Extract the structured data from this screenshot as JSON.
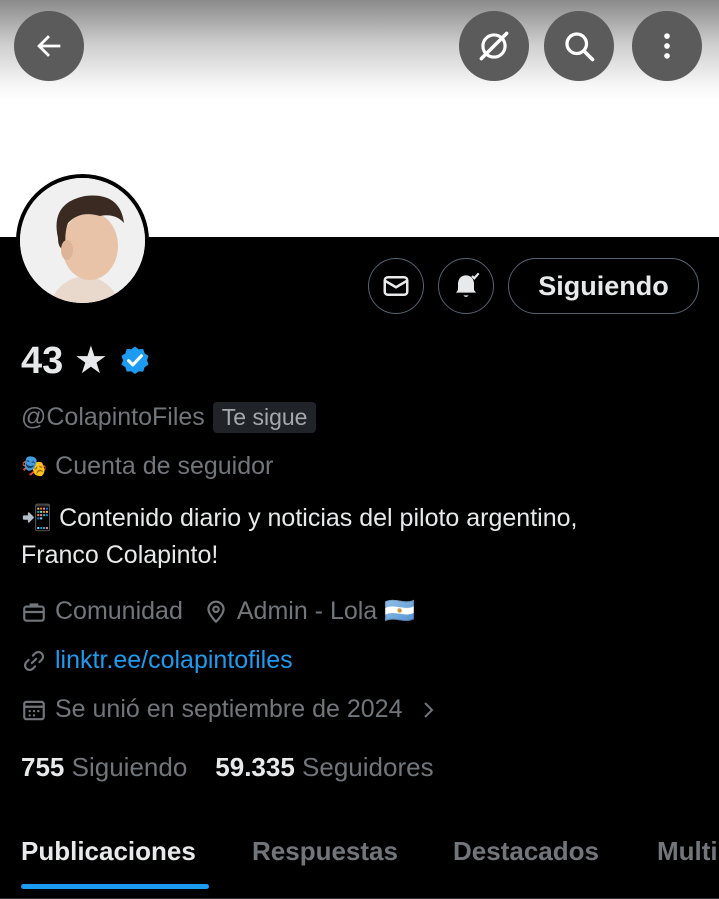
{
  "header": {
    "back_icon": "arrow-left-icon",
    "hide_icon": "eye-off-icon",
    "search_icon": "search-icon",
    "more_icon": "more-vertical-icon"
  },
  "profile": {
    "name": "43 ★",
    "verified": true,
    "handle": "@ColapintoFiles",
    "follows_you_badge": "Te sigue",
    "account_type_emoji": "🎭",
    "account_type": "Cuenta de seguidor",
    "bio_line1": "📲 Contenido diario y noticias del piloto argentino,",
    "bio_line2": "Franco Colapinto!",
    "category": "Comunidad",
    "location": "Admin - Lola 🇦🇷",
    "website": "linktr.ee/colapintofiles",
    "joined": "Se unió en septiembre de 2024"
  },
  "actions": {
    "follow_label": "Siguiendo"
  },
  "stats": {
    "following_count": "755",
    "following_label": "Siguiendo",
    "followers_count": "59.335",
    "followers_label": "Seguidores"
  },
  "tabs": [
    "Publicaciones",
    "Respuestas",
    "Destacados",
    "Multimedia"
  ],
  "colors": {
    "accent": "#1d9bf0",
    "background": "#000000",
    "muted_text": "#71767b"
  }
}
